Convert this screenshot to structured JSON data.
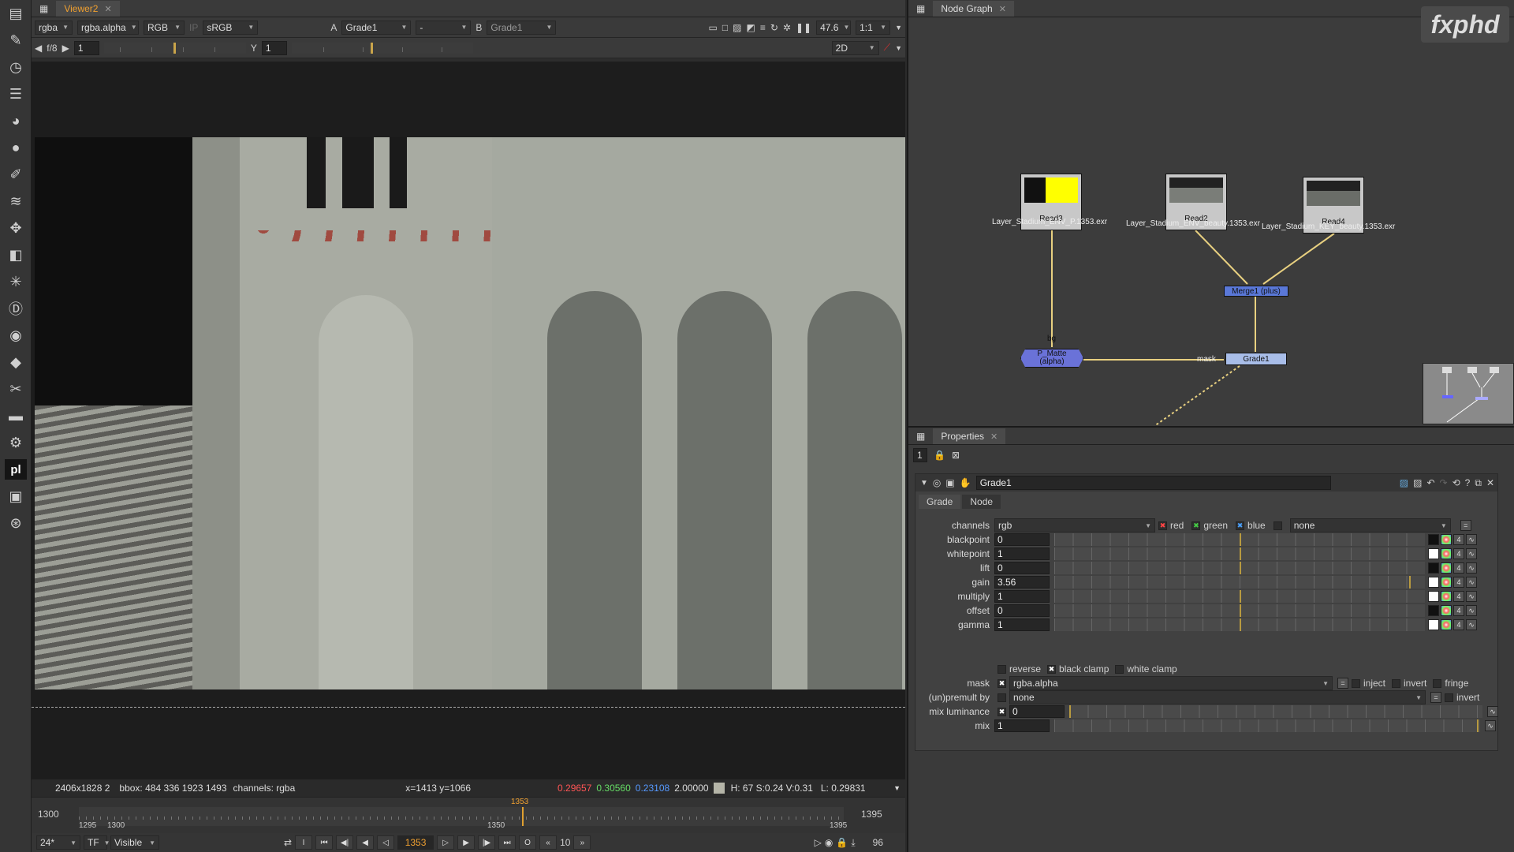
{
  "viewer": {
    "tab_title": "Viewer2",
    "channels": "rgba",
    "alpha_channel": "rgba.alpha",
    "color_mode": "RGB",
    "ip_label": "IP",
    "colorspace": "sRGB",
    "input_a_label": "A",
    "input_a": "Grade1",
    "wipe": "-",
    "input_b_label": "B",
    "input_b": "Grade1",
    "zoom": "47.6",
    "proxy": "1:1",
    "fstop": "f/8",
    "gain_value": "1",
    "gamma_label": "Y",
    "gamma_value": "1",
    "view_mode": "2D",
    "status": {
      "format": "2406x1828 2",
      "bbox": "bbox: 484 336 1923 1493",
      "channels": "channels: rgba",
      "coords": "x=1413 y=1066",
      "r": "0.29657",
      "g": "0.30560",
      "b": "0.23108",
      "a": "2.00000",
      "hsv": "H: 67 S:0.24 V:0.31",
      "lum": "L: 0.29831"
    },
    "timeline": {
      "in_frame": "1300",
      "out_frame": "1395",
      "tick_1295": "1295",
      "tick_1300": "1300",
      "tick_1350": "1350",
      "tick_1395": "1395",
      "cursor_label": "1353"
    },
    "playback": {
      "fps": "24*",
      "tf": "TF",
      "visible": "Visible",
      "current_frame": "1353",
      "increment": "10",
      "end_count": "96",
      "in_point": "I",
      "out_point": "O"
    }
  },
  "nodegraph": {
    "tab_title": "Node Graph",
    "logo": "fxphd",
    "nodes": {
      "read3": "Read3",
      "read3_file": "Layer_Stadium_ENV_P.1353.exr",
      "read2": "Read2",
      "read2_file": "Layer_Stadium_ENV_beauty.1353.exr",
      "read4": "Read4",
      "read4_file": "Layer_Stadium_KEY_beauty.1353.exr",
      "merge": "Merge1 (plus)",
      "matte": "P_Matte",
      "matte_sub": "(alpha)",
      "grade": "Grade1",
      "bg_label": "bg",
      "mask_label": "mask"
    }
  },
  "properties": {
    "tab_title": "Properties",
    "node_count": "1",
    "node_name": "Grade1",
    "tabs": [
      "Grade",
      "Node"
    ],
    "channels_label": "channels",
    "channels_value": "rgb",
    "red": "red",
    "green": "green",
    "blue": "blue",
    "alpha_value": "none",
    "params": [
      {
        "label": "blackpoint",
        "value": "0"
      },
      {
        "label": "whitepoint",
        "value": "1"
      },
      {
        "label": "lift",
        "value": "0"
      },
      {
        "label": "gain",
        "value": "3.56"
      },
      {
        "label": "multiply",
        "value": "1"
      },
      {
        "label": "offset",
        "value": "0"
      },
      {
        "label": "gamma",
        "value": "1"
      }
    ],
    "reverse": "reverse",
    "black_clamp": "black clamp",
    "white_clamp": "white clamp",
    "mask_label": "mask",
    "mask_value": "rgba.alpha",
    "inject": "inject",
    "invert": "invert",
    "fringe": "fringe",
    "premult_label": "(un)premult by",
    "premult_value": "none",
    "premult_invert": "invert",
    "mix_luminance_label": "mix luminance",
    "mix_luminance_value": "0",
    "mix_label": "mix",
    "mix_value": "1"
  },
  "colors": {
    "accent": "#f0a030",
    "merge_node": "#5a78d8",
    "grade_node": "#a8bde8",
    "red_value": "#ff5555",
    "green_value": "#66dd66",
    "blue_value": "#5599ff"
  }
}
